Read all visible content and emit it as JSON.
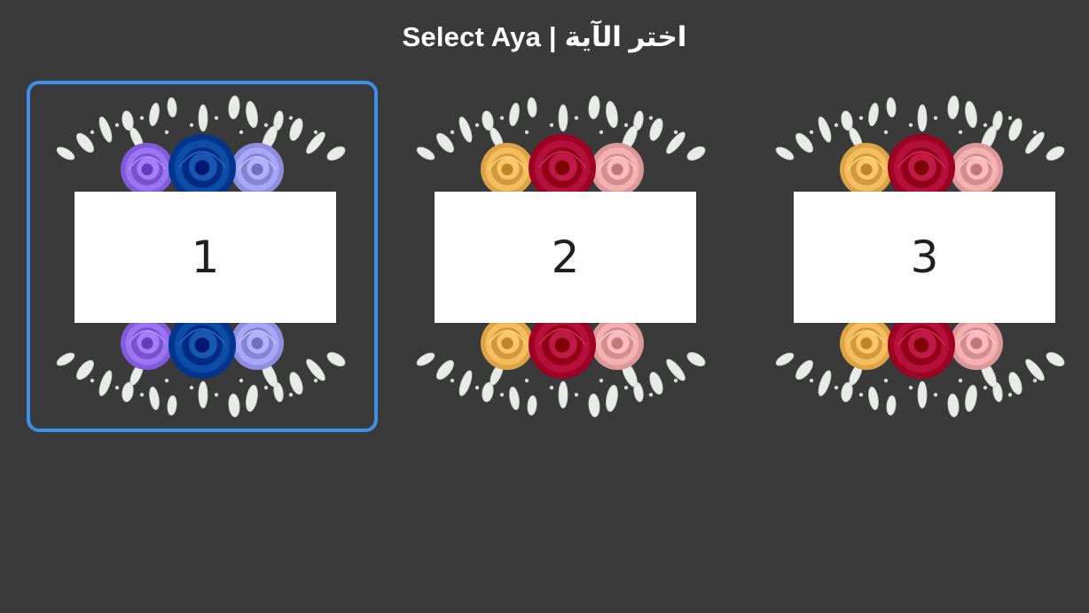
{
  "header": {
    "title": "Select Aya | اختر الآية"
  },
  "cards": [
    {
      "number": "1",
      "selected": true,
      "palette": {
        "left": "#9a74f2",
        "center": "#0d4da6",
        "right": "#a8a6f6"
      }
    },
    {
      "number": "2",
      "selected": false,
      "palette": {
        "left": "#f6bd5f",
        "center": "#b5103b",
        "right": "#f5b1b1"
      }
    },
    {
      "number": "3",
      "selected": false,
      "palette": {
        "left": "#f6bd5f",
        "center": "#b5103b",
        "right": "#f5b1b1"
      }
    }
  ],
  "colors": {
    "background": "#3a3a3a",
    "selection_border": "#3d8fea",
    "leaf": "#e9ebe9",
    "leaf_dark": "#c9cfc9"
  }
}
